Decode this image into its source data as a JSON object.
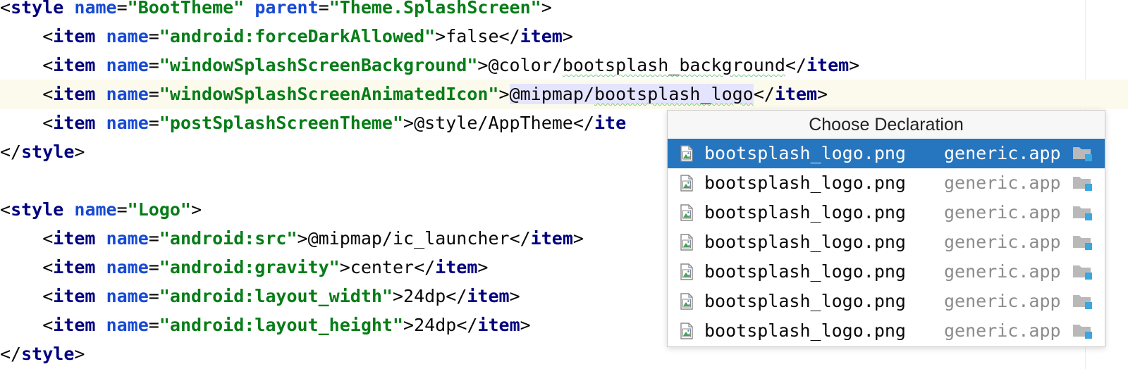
{
  "editor": {
    "line1": {
      "open": "<",
      "tag": "style",
      "attr1": "name",
      "eq1": "=",
      "val1": "\"BootTheme\"",
      "attr2": "parent",
      "eq2": "=",
      "val2": "\"Theme.SplashScreen\"",
      "close": ">"
    },
    "line2": {
      "indent": "    ",
      "open": "<",
      "tag": "item",
      "attr": "name",
      "eq": "=",
      "val": "\"android:forceDarkAllowed\"",
      "gt": ">",
      "text": "false",
      "endopen": "</",
      "endtag": "item",
      "endgt": ">"
    },
    "line3": {
      "indent": "    ",
      "open": "<",
      "tag": "item",
      "attr": "name",
      "eq": "=",
      "val": "\"windowSplashScreenBackground\"",
      "gt": ">",
      "text_a": "@color/",
      "text_b": "bootsplash_background",
      "endopen": "</",
      "endtag": "item",
      "endgt": ">"
    },
    "line4": {
      "indent": "    ",
      "open": "<",
      "tag": "item",
      "attr": "name",
      "eq": "=",
      "val": "\"windowSplashScreenAnimatedIcon\"",
      "gt": ">",
      "text_a": "@mipmap/",
      "text_b": "bootsplash_logo",
      "endopen": "</",
      "endtag": "item",
      "endgt": ">"
    },
    "line5": {
      "indent": "    ",
      "open": "<",
      "tag": "item",
      "attr": "name",
      "eq": "=",
      "val": "\"postSplashScreenTheme\"",
      "gt": ">",
      "text": "@style/AppTheme",
      "endopen": "</",
      "endtag": "ite"
    },
    "line6": {
      "open": "</",
      "tag": "style",
      "close": ">"
    },
    "line8": {
      "open": "<",
      "tag": "style",
      "attr": "name",
      "eq": "=",
      "val": "\"Logo\"",
      "close": ">"
    },
    "line9": {
      "indent": "    ",
      "open": "<",
      "tag": "item",
      "attr": "name",
      "eq": "=",
      "val": "\"android:src\"",
      "gt": ">",
      "text": "@mipmap/ic_launcher",
      "endopen": "</",
      "endtag": "item",
      "endgt": ">"
    },
    "line10": {
      "indent": "    ",
      "open": "<",
      "tag": "item",
      "attr": "name",
      "eq": "=",
      "val": "\"android:gravity\"",
      "gt": ">",
      "text": "center",
      "endopen": "</",
      "endtag": "item",
      "endgt": ">"
    },
    "line11": {
      "indent": "    ",
      "open": "<",
      "tag": "item",
      "attr": "name",
      "eq": "=",
      "val": "\"android:layout_width\"",
      "gt": ">",
      "text": "24dp",
      "endopen": "</",
      "endtag": "item",
      "endgt": ">"
    },
    "line12": {
      "indent": "    ",
      "open": "<",
      "tag": "item",
      "attr": "name",
      "eq": "=",
      "val": "\"android:layout_height\"",
      "gt": ">",
      "text": "24dp",
      "endopen": "</",
      "endtag": "item",
      "endgt": ">"
    },
    "line13": {
      "open": "</",
      "tag": "style",
      "close": ">"
    }
  },
  "popup": {
    "title": "Choose Declaration",
    "items": [
      {
        "file": "bootsplash_logo.png",
        "module": "generic.app"
      },
      {
        "file": "bootsplash_logo.png",
        "module": "generic.app"
      },
      {
        "file": "bootsplash_logo.png",
        "module": "generic.app"
      },
      {
        "file": "bootsplash_logo.png",
        "module": "generic.app"
      },
      {
        "file": "bootsplash_logo.png",
        "module": "generic.app"
      },
      {
        "file": "bootsplash_logo.png",
        "module": "generic.app"
      },
      {
        "file": "bootsplash_logo.png",
        "module": "generic.app"
      }
    ],
    "selected_index": 0
  },
  "colors": {
    "tag": "#000080",
    "attribute": "#174ad4",
    "value": "#067d17",
    "selection": "#2675bf",
    "current_line": "#fcfaed"
  },
  "icons": {
    "file": "image-file-icon",
    "module": "module-folder-icon"
  }
}
